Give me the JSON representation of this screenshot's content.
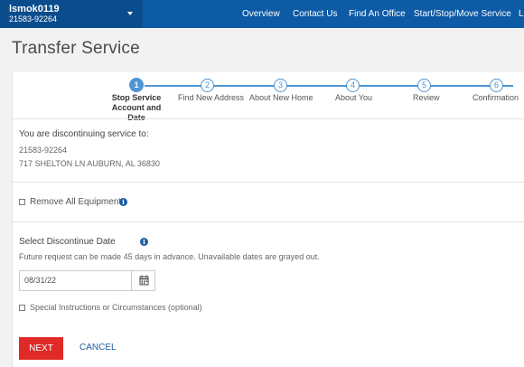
{
  "header": {
    "account_user": "lsmok0119",
    "account_number": "21583-92264",
    "nav": [
      "Overview",
      "Contact Us",
      "Find An Office",
      "Start/Stop/Move Service",
      "L"
    ]
  },
  "page": {
    "title": "Transfer Service"
  },
  "steps": [
    {
      "num": "1",
      "label": "Stop Service Account and Date"
    },
    {
      "num": "2",
      "label": "Find New Address"
    },
    {
      "num": "3",
      "label": "About New Home"
    },
    {
      "num": "4",
      "label": "About You"
    },
    {
      "num": "5",
      "label": "Review"
    },
    {
      "num": "6",
      "label": "Confirmation"
    }
  ],
  "current_step": 1,
  "discontinue": {
    "heading": "You are discontinuing service to:",
    "account": "21583-92264",
    "address": "717 SHELTON LN AUBURN, AL 36830"
  },
  "equipment": {
    "label": "Remove All Equipment",
    "checked": false
  },
  "date_section": {
    "label": "Select Discontinue Date",
    "note": "Future request can be made 45 days in advance. Unavailable dates are grayed out.",
    "value": "08/31/22"
  },
  "special": {
    "label": "Special Instructions or Circumstances (optional)",
    "checked": false
  },
  "actions": {
    "next": "NEXT",
    "cancel": "CANCEL"
  },
  "icons": {
    "info": "info-icon",
    "calendar": "calendar-icon",
    "caret": "chevron-down-icon"
  },
  "colors": {
    "brand": "#0d5aa5",
    "accent": "#4d95d4",
    "primary_button": "#e02a28",
    "link": "#1d5da2"
  }
}
